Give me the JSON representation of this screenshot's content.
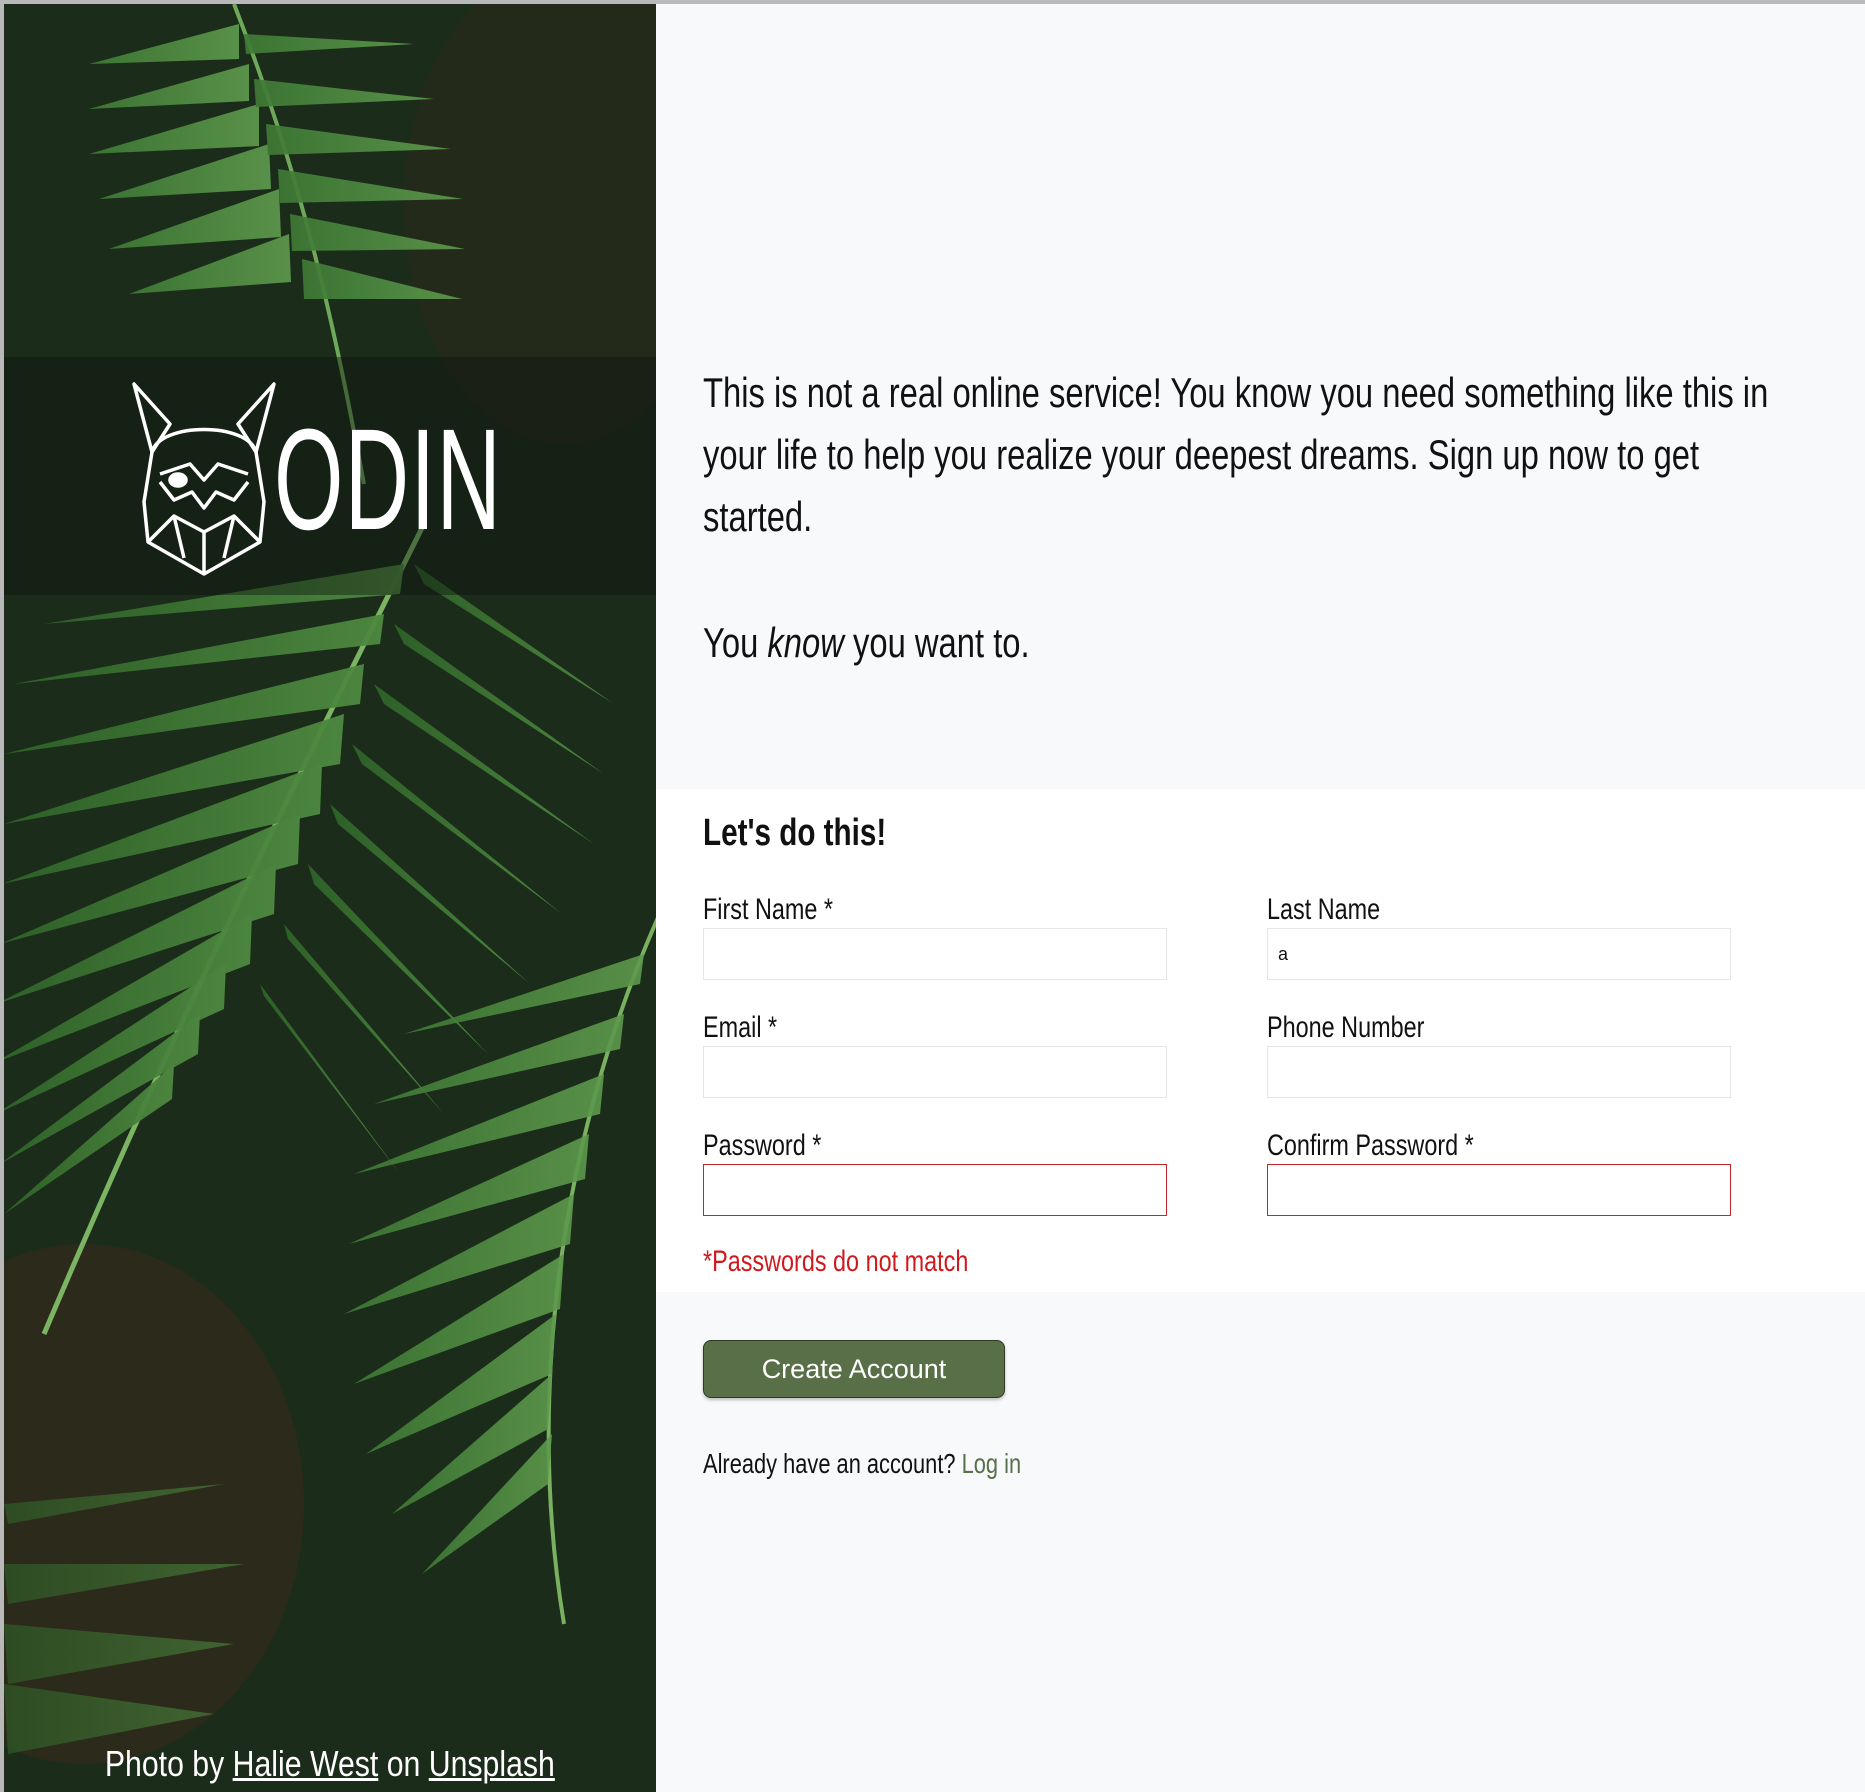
{
  "brand": {
    "logo_icon": "viking-helmet-icon",
    "name": "ODIN"
  },
  "credit": {
    "prefix": "Photo by",
    "photographer": "Halie West",
    "middle": "on",
    "site": "Unsplash"
  },
  "intro": {
    "lines": [
      "This is not a real online service! You know you need something like this in",
      "your life to help you realize your deepest dreams. Sign up now to get",
      "started."
    ],
    "tag_before": "You",
    "tag_em": "know",
    "tag_after": "you want to."
  },
  "form": {
    "heading": "Let's do this!",
    "first_name": {
      "label": "First Name *",
      "value": ""
    },
    "last_name": {
      "label": "Last Name",
      "value": "a"
    },
    "email": {
      "label": "Email *",
      "value": ""
    },
    "phone": {
      "label": "Phone Number",
      "value": ""
    },
    "password": {
      "label": "Password *",
      "value": ""
    },
    "confirm_password": {
      "label": "Confirm Password *",
      "value": ""
    },
    "error": "*Passwords do not match",
    "submit_label": "Create Account",
    "login_prompt": "Already have an account?",
    "login_link": "Log in"
  },
  "colors": {
    "accent": "#586f48",
    "error": "#d0191f",
    "panel_bg": "#f8f9fb"
  }
}
